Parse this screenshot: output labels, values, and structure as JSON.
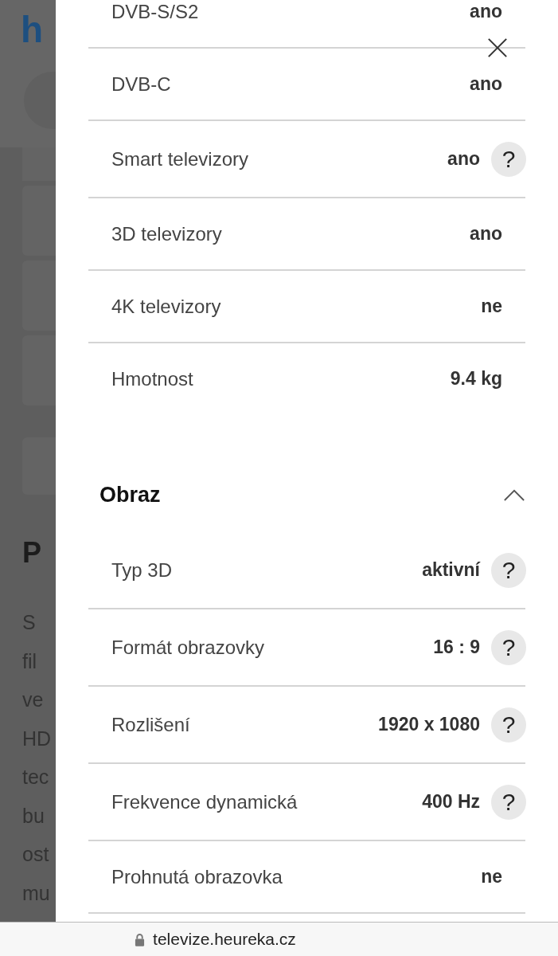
{
  "background_page": {
    "logo": "h",
    "heading": "P",
    "paragraph_lines": [
      "S",
      "fil",
      "ve",
      "HD",
      "tec",
      "bu",
      "ost",
      "mu"
    ]
  },
  "dialog": {
    "sections": [
      {
        "rows": [
          {
            "label": "DVB-S/S2",
            "value": "ano"
          },
          {
            "label": "DVB-C",
            "value": "ano"
          },
          {
            "label": "Smart televizory",
            "value": "ano",
            "help": "?"
          },
          {
            "label": "3D televizory",
            "value": "ano"
          },
          {
            "label": "4K televizory",
            "value": "ne"
          },
          {
            "label": "Hmotnost",
            "value": "9.4 kg"
          }
        ]
      },
      {
        "title": "Obraz",
        "expanded": true,
        "rows": [
          {
            "label": "Typ 3D",
            "value": "aktivní",
            "help": "?"
          },
          {
            "label": "Formát obrazovky",
            "value": "16 : 9",
            "help": "?"
          },
          {
            "label": "Rozlišení",
            "value": "1920 x 1080",
            "help": "?"
          },
          {
            "label": "Frekvence dynamická",
            "value": "400 Hz",
            "help": "?"
          },
          {
            "label": "Prohnutá obrazovka",
            "value": "ne"
          }
        ]
      }
    ]
  },
  "address_bar": {
    "url": "televize.heureka.cz"
  }
}
